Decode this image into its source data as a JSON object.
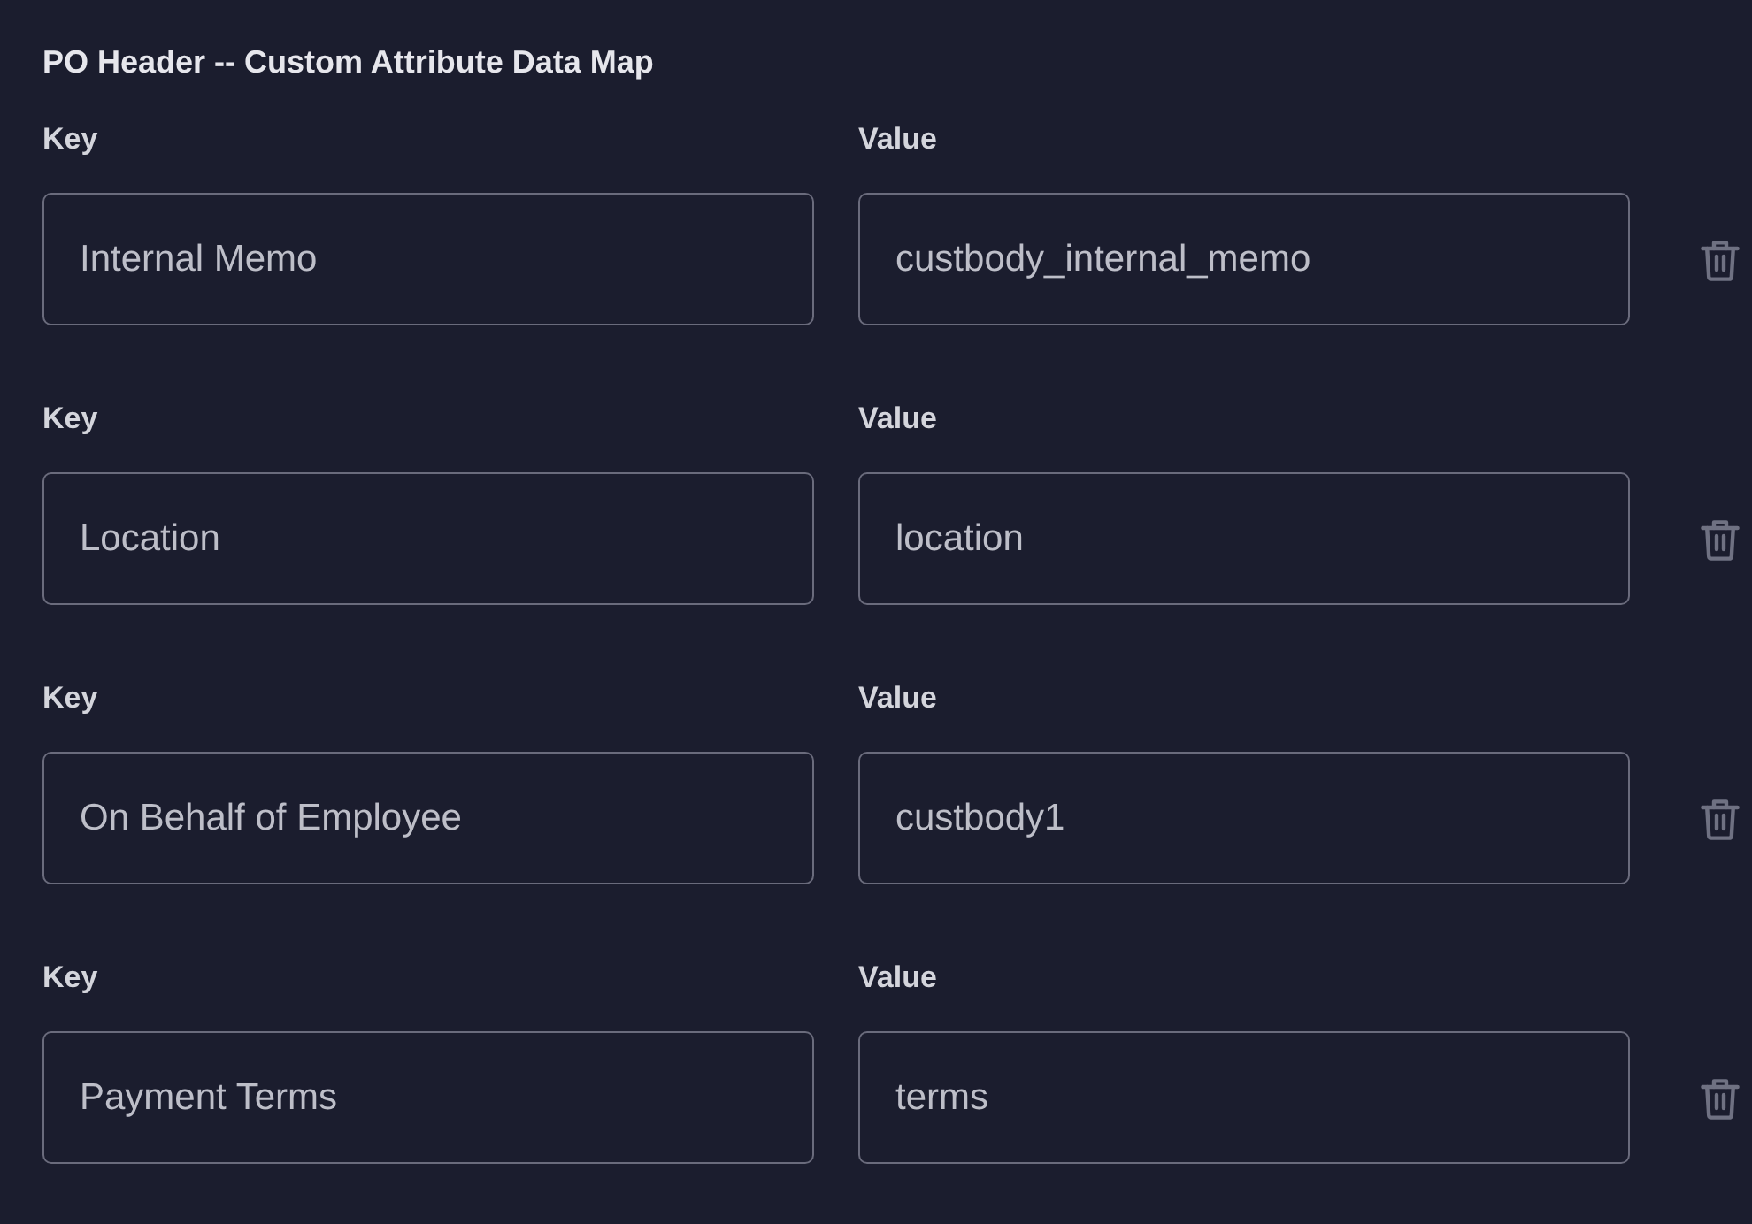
{
  "section": {
    "title": "PO Header -- Custom Attribute Data Map",
    "rows": [
      {
        "key_label": "Key",
        "key": "Internal Memo",
        "value_label": "Value",
        "value": "custbody_internal_memo"
      },
      {
        "key_label": "Key",
        "key": "Location",
        "value_label": "Value",
        "value": "location"
      },
      {
        "key_label": "Key",
        "key": "On Behalf of Employee",
        "value_label": "Value",
        "value": "custbody1"
      },
      {
        "key_label": "Key",
        "key": "Payment Terms",
        "value_label": "Value",
        "value": "terms"
      }
    ]
  }
}
